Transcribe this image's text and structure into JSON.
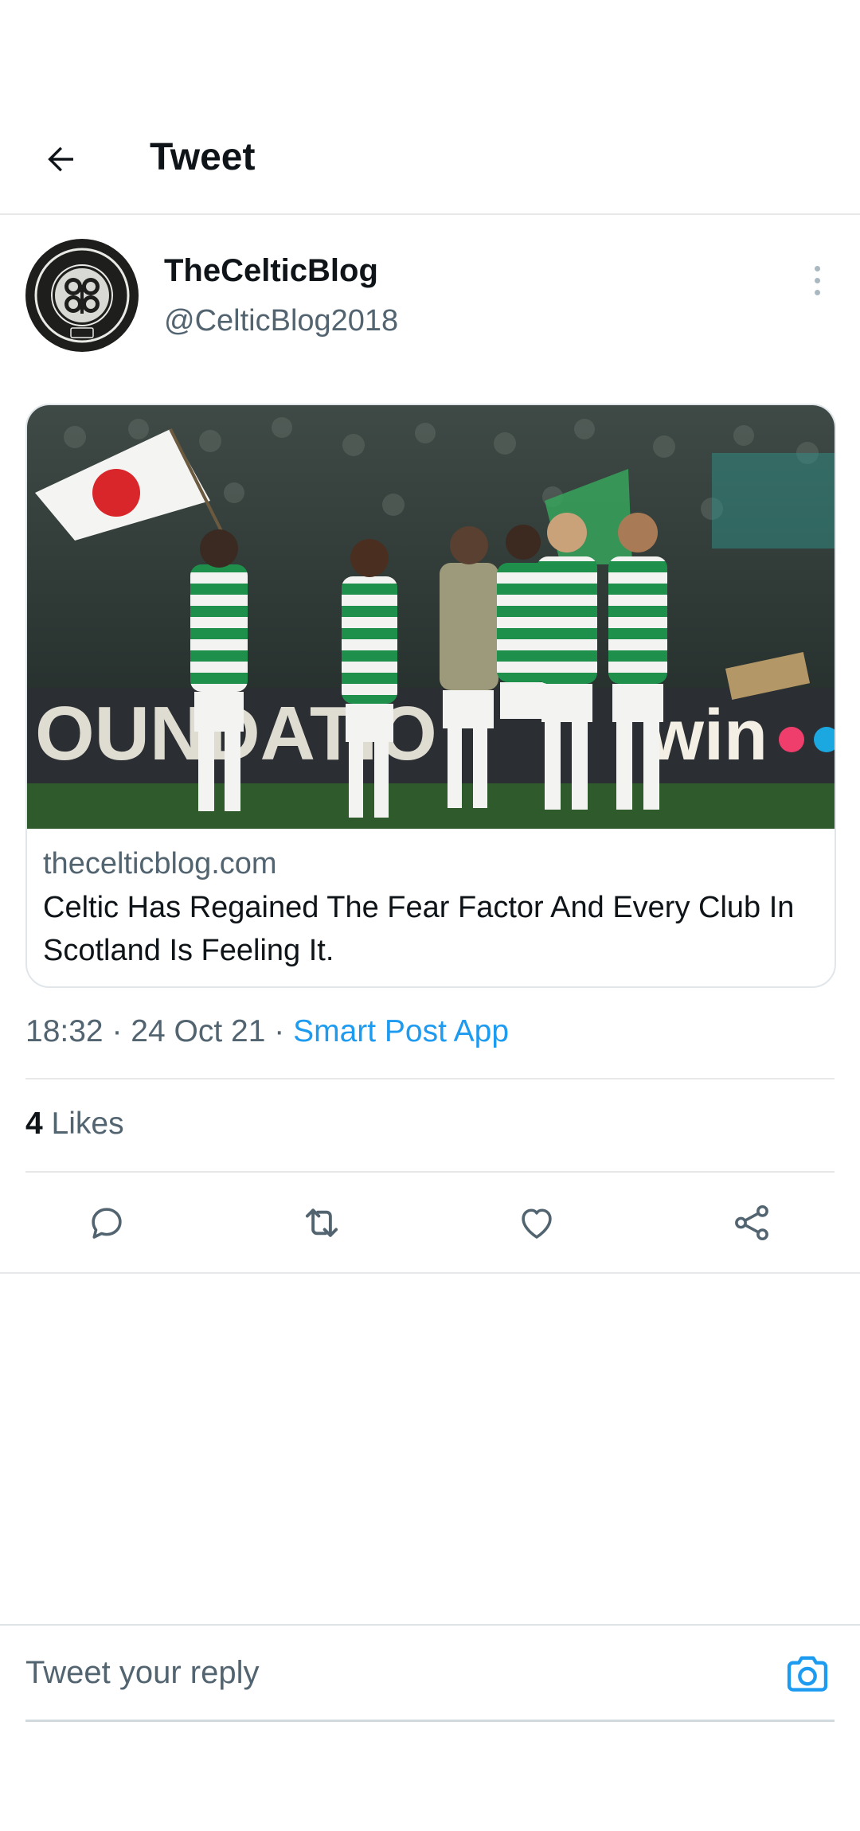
{
  "header": {
    "title": "Tweet",
    "back_icon": "arrow-left-icon"
  },
  "author": {
    "name": "TheCelticBlog",
    "handle": "@CelticBlog2018",
    "avatar_icon": "celtic-crest-avatar",
    "avatar_text": "THE CELTIC FOOTBALL CLUB 1888"
  },
  "link_card": {
    "domain": "thecelticblog.com",
    "title": "Celtic Has Regained The Fear Factor And Every Club In Scotland Is Feeling It.",
    "image_desc_icon": "celtic-players-photo",
    "board_text": "OUNDATIO"
  },
  "meta": {
    "time": "18:32",
    "separator": " · ",
    "date": "24 Oct 21",
    "app": "Smart Post App"
  },
  "likes": {
    "count": "4",
    "label": "Likes"
  },
  "actions": {
    "reply_icon": "reply-icon",
    "retweet_icon": "retweet-icon",
    "like_icon": "heart-icon",
    "share_icon": "share-icon"
  },
  "reply": {
    "placeholder": "Tweet your reply",
    "camera_icon": "camera-icon"
  },
  "colors": {
    "accent": "#1d9bf0",
    "secondary_text": "#536471",
    "divider": "#e6e8ea",
    "celtic_green": "#1b8a4a"
  }
}
